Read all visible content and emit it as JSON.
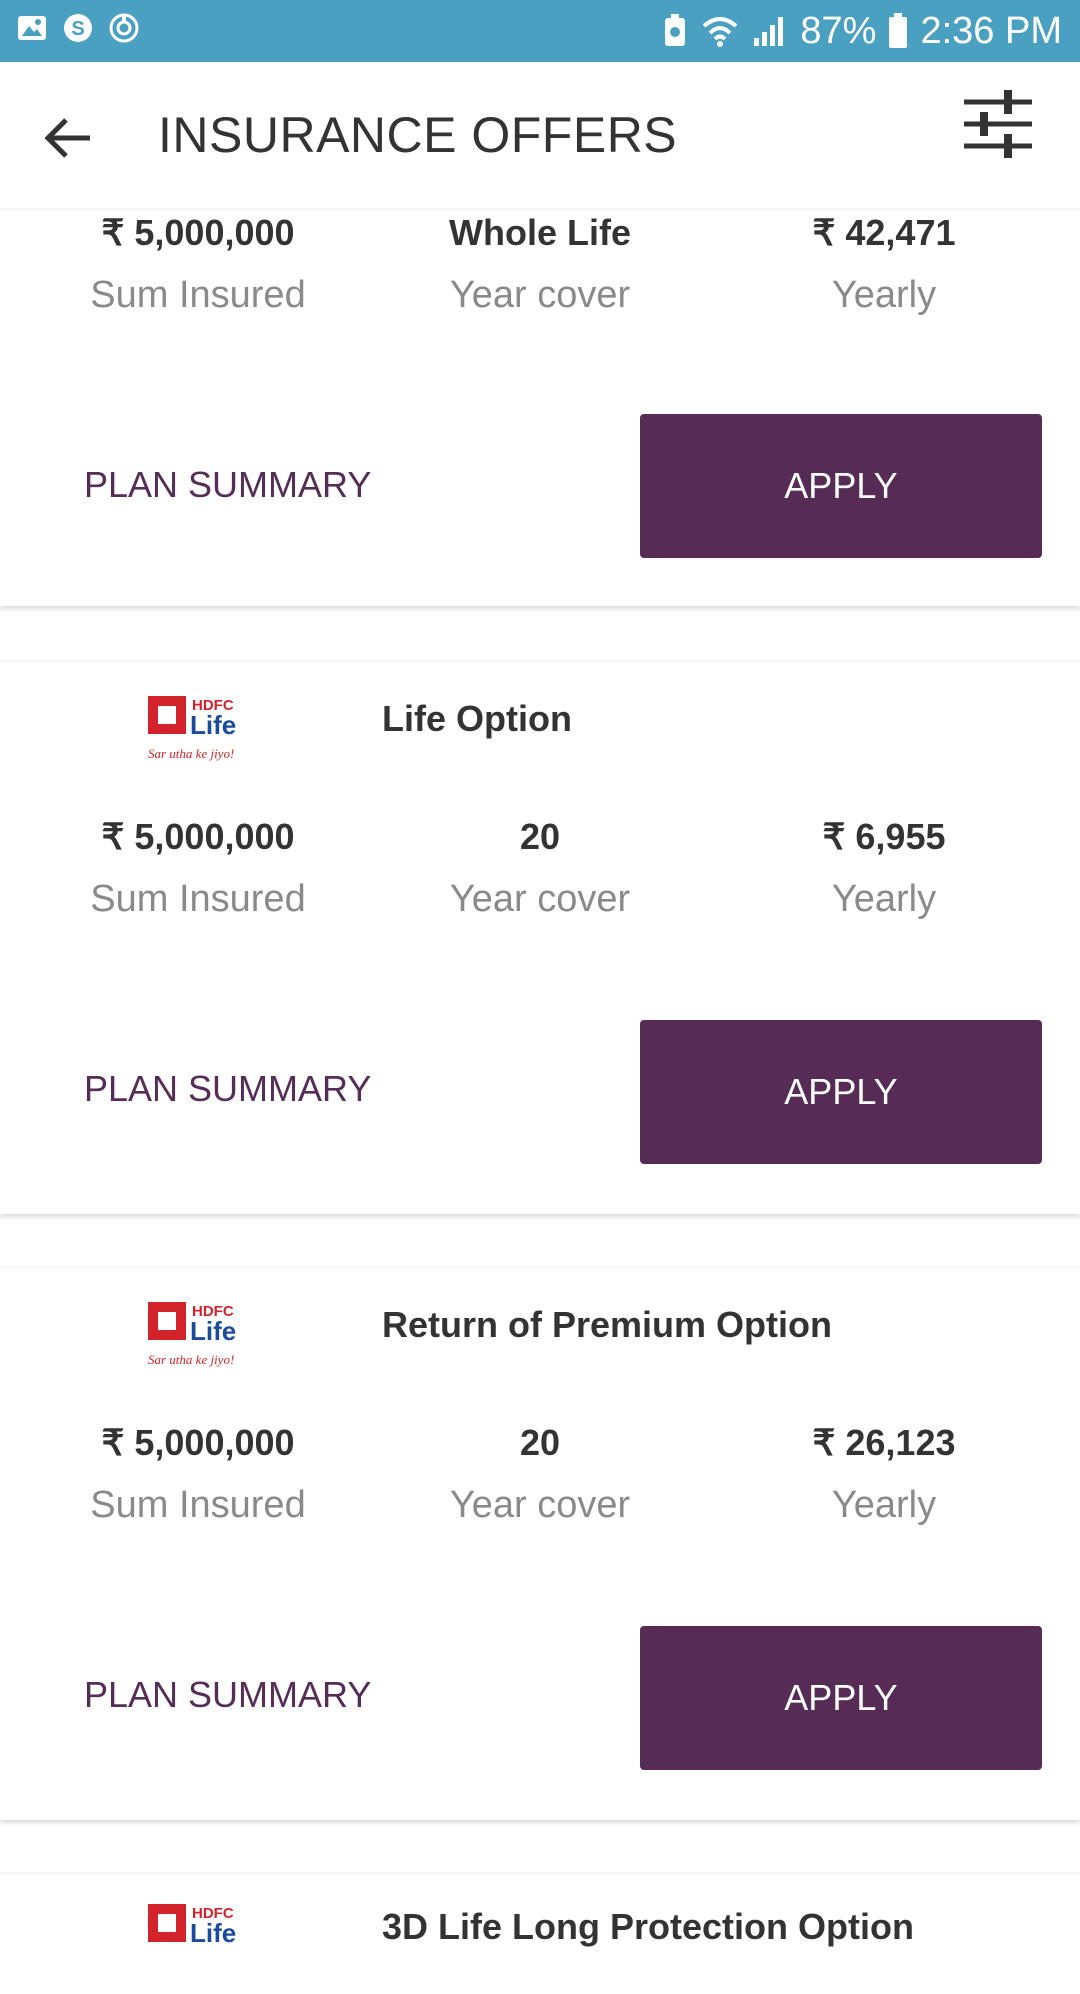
{
  "status_bar": {
    "battery": "87%",
    "time": "2:36 PM",
    "left_icons": [
      "gallery-icon",
      "skype-icon",
      "sync-icon"
    ],
    "right_icons": [
      "battery-saver-icon",
      "wifi-icon",
      "signal-icon",
      "battery-icon"
    ],
    "color": "#4aa0c0"
  },
  "header": {
    "title": "INSURANCE OFFERS",
    "back_icon": "arrow-left-icon",
    "filter_icon": "sliders-icon"
  },
  "labels": {
    "sum_insured": "Sum Insured",
    "year_cover": "Year cover",
    "yearly": "Yearly",
    "plan_summary": "PLAN SUMMARY",
    "apply": "APPLY"
  },
  "offers": [
    {
      "plan_name": "",
      "sum_insured": "₹ 5,000,000",
      "cover": "Whole Life",
      "premium": "₹ 42,471"
    },
    {
      "insurer_logo": "HDFC Life",
      "logo_tagline": "Sar utha ke jiyo!",
      "plan_name": "Life Option",
      "sum_insured": "₹ 5,000,000",
      "cover": "20",
      "premium": "₹ 6,955"
    },
    {
      "insurer_logo": "HDFC Life",
      "logo_tagline": "Sar utha ke jiyo!",
      "plan_name": "Return of Premium Option",
      "sum_insured": "₹ 5,000,000",
      "cover": "20",
      "premium": "₹ 26,123"
    },
    {
      "insurer_logo": "HDFC Life",
      "plan_name": "3D Life Long Protection Option"
    }
  ],
  "colors": {
    "primary": "#562b55",
    "muted_text": "#8a8a8a"
  }
}
